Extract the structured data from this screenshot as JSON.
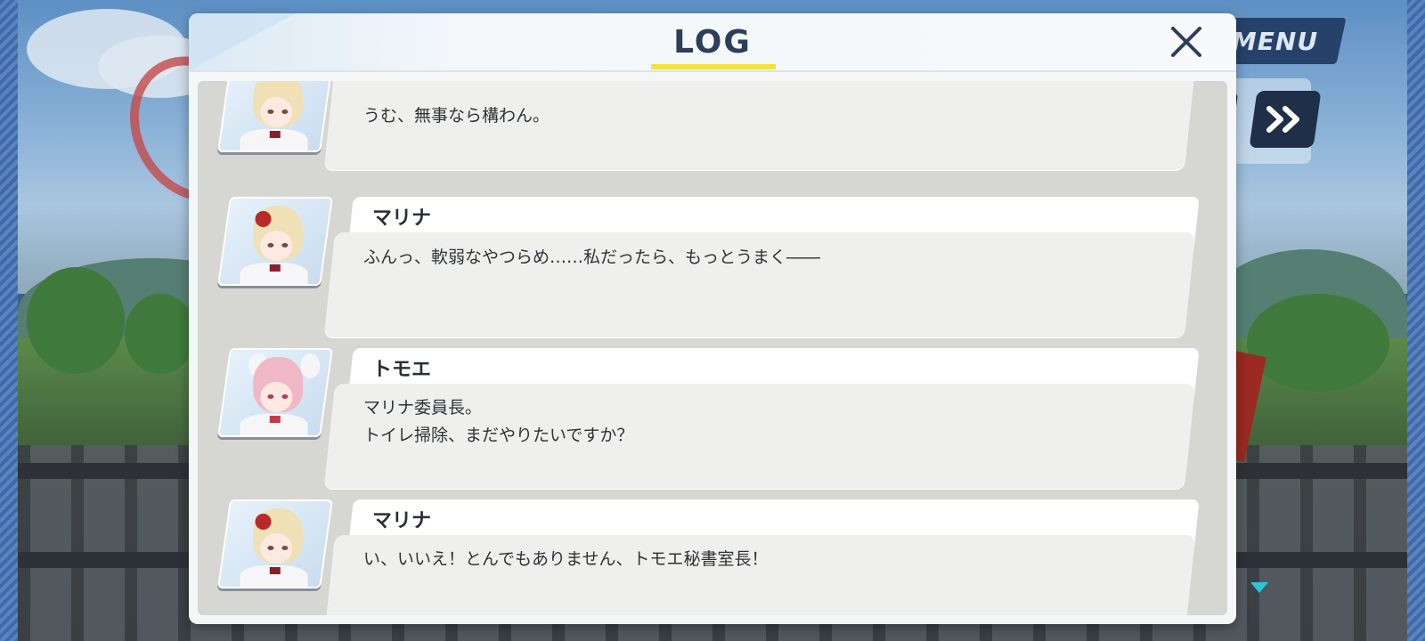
{
  "hud": {
    "menu_label": "MENU",
    "icons": [
      "fast-forward-icon",
      "auto-icon",
      "down-arrow-icon"
    ]
  },
  "dialog": {
    "title": "LOG",
    "close_icon": "close-icon",
    "accent_color": "#f5e23b"
  },
  "entries": [
    {
      "speaker": "",
      "portrait": "marina-portrait",
      "message": "うむ、無事なら構わん。"
    },
    {
      "speaker": "マリナ",
      "portrait": "marina-portrait",
      "message": "ふんっ、軟弱なやつらめ……私だったら、もっとうまく――"
    },
    {
      "speaker": "トモエ",
      "portrait": "tomoe-portrait",
      "message": "マリナ委員長。\nトイレ掃除、まだやりたいですか？"
    },
    {
      "speaker": "マリナ",
      "portrait": "marina-portrait",
      "message": "い、いいえ！とんでもありません、トモエ秘書室長！"
    }
  ]
}
